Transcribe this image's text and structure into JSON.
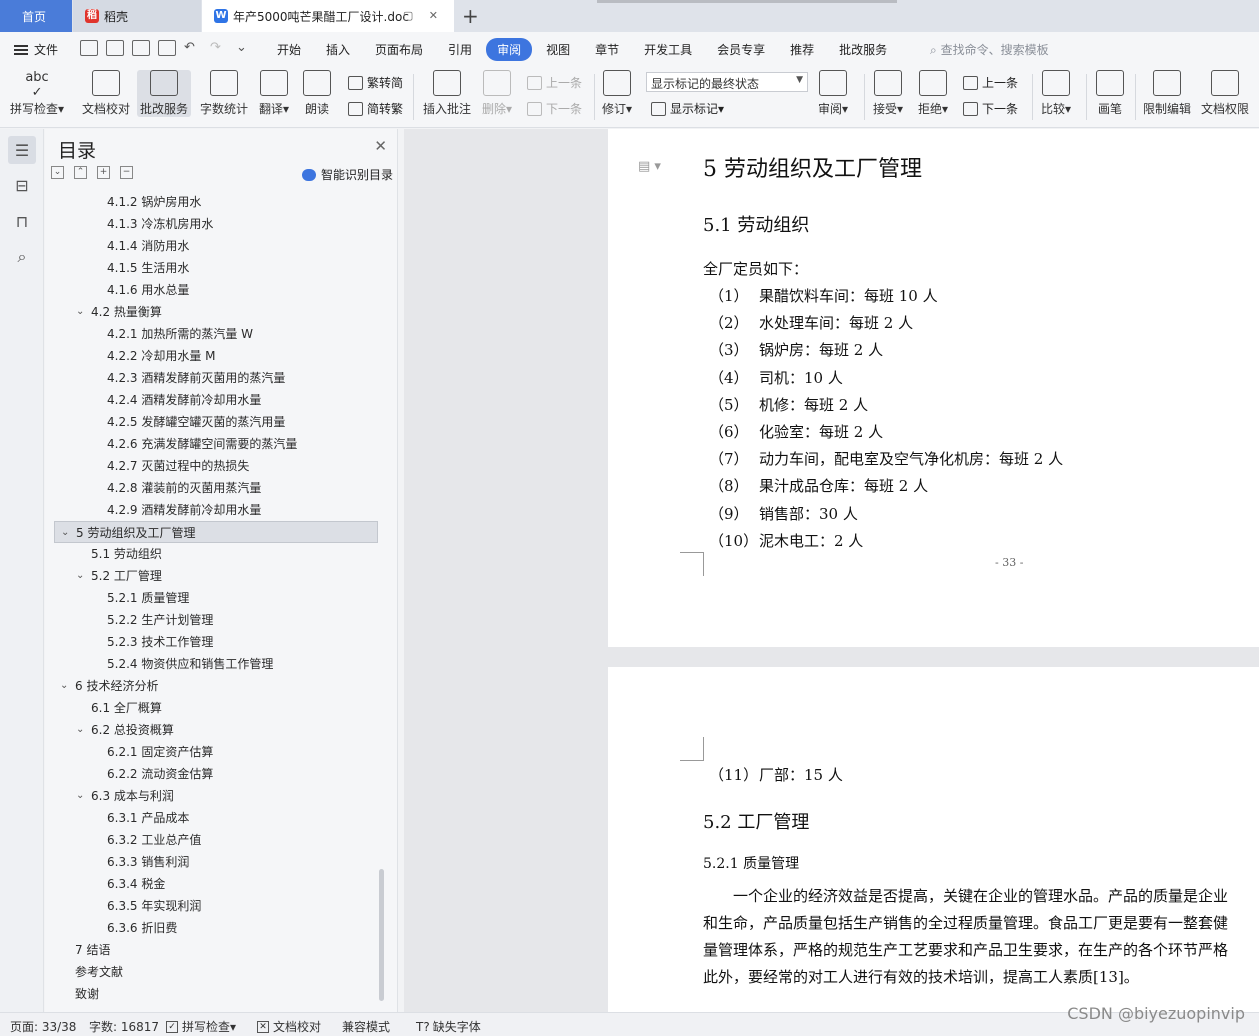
{
  "tabs": {
    "home": "首页",
    "daoke": "稻壳",
    "document": "年产5000吨芒果醋工厂设计.doc",
    "add": "+"
  },
  "menu": {
    "file": "文件",
    "items": [
      "开始",
      "插入",
      "页面布局",
      "引用",
      "审阅",
      "视图",
      "章节",
      "开发工具",
      "会员专享",
      "推荐",
      "批改服务"
    ],
    "active": "审阅",
    "search_placeholder": "查找命令、搜索模板"
  },
  "ribbon": {
    "spell_check": "拼写检查",
    "doc_proof": "文档校对",
    "correction_service": "批改服务",
    "word_count": "字数统计",
    "translate": "翻译",
    "read_aloud": "朗读",
    "trad_to_simp": "繁转简",
    "simp_to_trad": "简转繁",
    "insert_comment": "插入批注",
    "delete": "删除",
    "prev": "上一条",
    "next": "下一条",
    "track_changes": "修订",
    "markup_state": "显示标记的最终状态",
    "show_markup": "显示标记",
    "review": "审阅",
    "accept": "接受",
    "reject": "拒绝",
    "prev2": "上一条",
    "next2": "下一条",
    "compare": "比较",
    "pen": "画笔",
    "restrict_edit": "限制编辑",
    "doc_permission": "文档权限"
  },
  "toc": {
    "title": "目录",
    "smart_label": "智能识别目录",
    "items": [
      {
        "text": "4.1.2  锅炉房用水",
        "level": 3
      },
      {
        "text": "4.1.3  冷冻机房用水",
        "level": 3
      },
      {
        "text": "4.1.4  消防用水",
        "level": 3
      },
      {
        "text": "4.1.5  生活用水",
        "level": 3
      },
      {
        "text": "4.1.6  用水总量",
        "level": 3
      },
      {
        "text": "4.2  热量衡算",
        "level": 2,
        "expanded": true
      },
      {
        "text": "4.2.1  加热所需的蒸汽量 W",
        "level": 3
      },
      {
        "text": "4.2.2  冷却用水量 M",
        "level": 3
      },
      {
        "text": "4.2.3  酒精发酵前灭菌用的蒸汽量",
        "level": 3
      },
      {
        "text": "4.2.4  酒精发酵前冷却用水量",
        "level": 3
      },
      {
        "text": "4.2.5  发酵罐空罐灭菌的蒸汽用量",
        "level": 3
      },
      {
        "text": "4.2.6  充满发酵罐空间需要的蒸汽量",
        "level": 3
      },
      {
        "text": "4.2.7  灭菌过程中的热损失",
        "level": 3
      },
      {
        "text": "4.2.8  灌装前的灭菌用蒸汽量",
        "level": 3
      },
      {
        "text": "4.2.9  酒精发酵前冷却用水量",
        "level": 3
      },
      {
        "text": "5  劳动组织及工厂管理",
        "level": 1,
        "expanded": true,
        "selected": true
      },
      {
        "text": "5.1  劳动组织",
        "level": 2
      },
      {
        "text": "5.2  工厂管理",
        "level": 2,
        "expanded": true
      },
      {
        "text": "5.2.1 质量管理",
        "level": 3
      },
      {
        "text": "5.2.2  生产计划管理",
        "level": 3
      },
      {
        "text": "5.2.3  技术工作管理",
        "level": 3
      },
      {
        "text": "5.2.4  物资供应和销售工作管理",
        "level": 3
      },
      {
        "text": "6  技术经济分析",
        "level": 1,
        "expanded": true
      },
      {
        "text": "6.1  全厂概算",
        "level": 2
      },
      {
        "text": "6.2  总投资概算",
        "level": 2,
        "expanded": true
      },
      {
        "text": "6.2.1 固定资产估算",
        "level": 3
      },
      {
        "text": "6.2.2  流动资金估算",
        "level": 3
      },
      {
        "text": "6.3  成本与利润",
        "level": 2,
        "expanded": true
      },
      {
        "text": "6.3.1  产品成本",
        "level": 3
      },
      {
        "text": "6.3.2  工业总产值",
        "level": 3
      },
      {
        "text": "6.3.3  销售利润",
        "level": 3
      },
      {
        "text": "6.3.4  税金",
        "level": 3
      },
      {
        "text": "6.3.5 年实现利润",
        "level": 3
      },
      {
        "text": "6.3.6  折旧费",
        "level": 3
      },
      {
        "text": "7  结语",
        "level": 1
      },
      {
        "text": "参考文献",
        "level": 1
      },
      {
        "text": "致谢",
        "level": 1
      }
    ]
  },
  "document": {
    "chapter_heading": "5  劳动组织及工厂管理",
    "section_heading": "5.1  劳动组织",
    "intro": "全厂定员如下：",
    "staff": [
      {
        "num": "（1）",
        "text": "果醋饮料车间：每班 10 人"
      },
      {
        "num": "（2）",
        "text": "水处理车间：每班 2 人"
      },
      {
        "num": "（3）",
        "text": "锅炉房：每班 2 人"
      },
      {
        "num": "（4）",
        "text": "司机：10 人"
      },
      {
        "num": "（5）",
        "text": "机修：每班 2 人"
      },
      {
        "num": "（6）",
        "text": "化验室：每班 2 人"
      },
      {
        "num": "（7）",
        "text": "动力车间，配电室及空气净化机房：每班 2 人"
      },
      {
        "num": "（8）",
        "text": "果汁成品仓库：每班 2 人"
      },
      {
        "num": "（9）",
        "text": "销售部：30 人"
      },
      {
        "num": "（10）",
        "text": "泥木电工：2 人"
      }
    ],
    "page_number": "- 33 -",
    "staff_cont": {
      "num": "（11）",
      "text": "厂部：15 人"
    },
    "section2_heading": "5.2  工厂管理",
    "subsection_heading": "5.2.1 质量管理",
    "para_lines": [
      "一个企业的经济效益是否提高，关键在企业的管理水品。产品的质量是企业",
      "和生命，产品质量包括生产销售的全过程质量管理。食品工厂更是要有一整套健",
      "量管理体系，严格的规范生产工艺要求和产品卫生要求，在生产的各个环节严格",
      "此外，要经常的对工人进行有效的技术培训，提高工人素质[13]。"
    ]
  },
  "status": {
    "page": "页面: 33/38",
    "words": "字数: 16817",
    "spell": "拼写检查",
    "proof": "文档校对",
    "compat": "兼容模式",
    "missing_font": "缺失字体"
  },
  "watermark": "CSDN @biyezuopinvip"
}
